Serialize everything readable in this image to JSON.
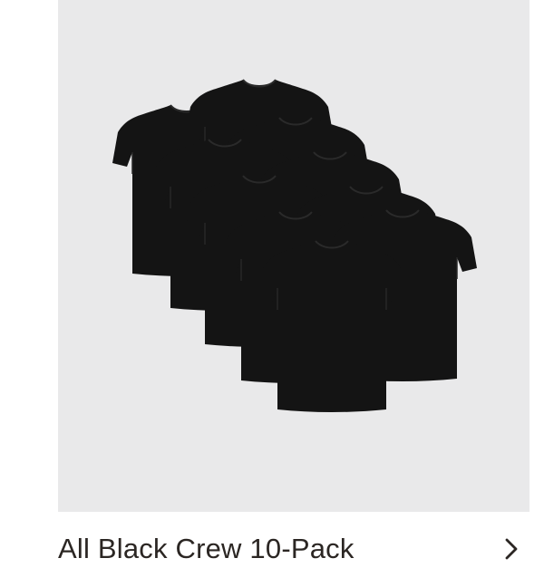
{
  "product": {
    "image_alt": "All Black Crew 10-Pack",
    "image_icon": "stacked-black-tshirts",
    "image_background": "#e9e9ea",
    "shirt_color": "#141414",
    "title": "All Black Crew 10-Pack",
    "action_icon": "chevron-right-icon",
    "text_color": "#2b2623"
  }
}
